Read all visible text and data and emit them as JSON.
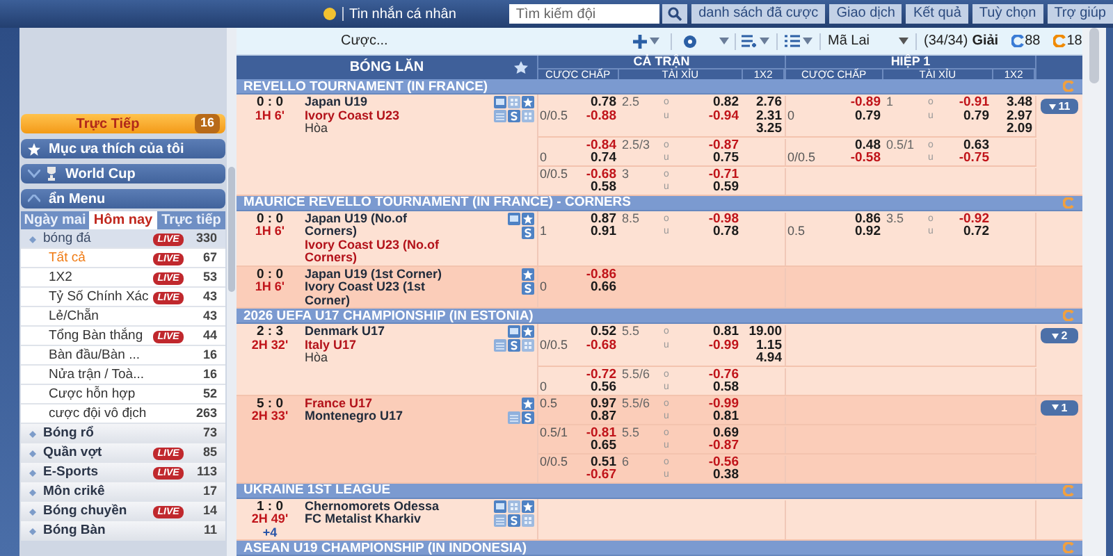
{
  "top_bar": {
    "messages": "Tin nhắn cá nhân",
    "search": {
      "placeholder": "Tìm kiếm đội"
    },
    "buttons": [
      "danh sách đã cược",
      "Giao dịch",
      "Kết quả",
      "Tuỳ chọn",
      "Trợ giúp"
    ]
  },
  "toolbar": {
    "bet_label": "Cược...",
    "region": "Mã Lai",
    "leagues_count": "(34/34)",
    "leagues_label": "Giải",
    "counters": [
      {
        "value": "88",
        "color": "#3a7bd5"
      },
      {
        "value": "18",
        "color": "#f08a00"
      }
    ]
  },
  "sidebar": {
    "live": {
      "label": "Trực Tiếp",
      "count": "16"
    },
    "sections": [
      {
        "label": "Mục ưa thích của tôi",
        "kind": "favorites"
      },
      {
        "label": "World Cup",
        "kind": "trophy"
      },
      {
        "label": "ẩn Menu",
        "kind": "collapse"
      }
    ],
    "tabs": [
      {
        "label": "Ngày mai",
        "selected": false
      },
      {
        "label": "Hôm nay",
        "selected": true
      },
      {
        "label": "Trực tiếp",
        "selected": false
      }
    ],
    "sports": [
      {
        "name": "bóng đá",
        "badge": "LIVE",
        "count": "330",
        "expanded": true,
        "children": [
          {
            "name": "Tất cả",
            "badge": "LIVE",
            "count": "67",
            "selected": true
          },
          {
            "name": "1X2",
            "badge": "LIVE",
            "count": "53",
            "selected": false
          },
          {
            "name": "Tỷ Số Chính Xác",
            "badge": "LIVE",
            "count": "43",
            "selected": false
          },
          {
            "name": "Lẻ/Chẵn",
            "count": "43",
            "selected": false
          },
          {
            "name": "Tổng Bàn thắng",
            "badge": "LIVE",
            "count": "44",
            "selected": false
          },
          {
            "name": "Bàn đầu/Bàn ...",
            "count": "16",
            "selected": false
          },
          {
            "name": "Nửa trận / Toà...",
            "count": "16",
            "selected": false
          },
          {
            "name": "Cược hỗn hợp",
            "count": "52",
            "selected": false
          },
          {
            "name": "cược đội vô địch",
            "count": "263",
            "selected": false
          }
        ]
      },
      {
        "name": "Bóng rổ",
        "count": "73",
        "expanded": false
      },
      {
        "name": "Quần vợt",
        "badge": "LIVE",
        "count": "85",
        "expanded": false
      },
      {
        "name": "E-Sports",
        "badge": "LIVE",
        "count": "113",
        "expanded": false
      },
      {
        "name": "Môn crikê",
        "count": "17",
        "expanded": false
      },
      {
        "name": "Bóng chuyền",
        "badge": "LIVE",
        "count": "14",
        "expanded": false
      },
      {
        "name": "Bóng Bàn",
        "count": "11",
        "expanded": false
      }
    ]
  },
  "table": {
    "title": "BÓNG LĂN",
    "groups": [
      {
        "label": "CẢ TRẬN",
        "columns": [
          "CƯỢC CHẤP",
          "TÀI XỈU",
          "1X2"
        ]
      },
      {
        "label": "HIỆP 1",
        "columns": [
          "CƯỢC CHẤP",
          "TÀI XỈU",
          "1X2"
        ]
      }
    ],
    "leagues": [
      {
        "name": "REVELLO TOURNAMENT (IN FRANCE)",
        "matches": [
          {
            "score": "0 : 0",
            "time": "1H 6'",
            "teams": [
              {
                "name": "Japan U19",
                "favorite": false
              },
              {
                "name": "Ivory Coast U23",
                "favorite": true
              }
            ],
            "draw": "Hòa",
            "tools": {
              "tv": true,
              "stats_top": true,
              "favorite": true,
              "calendar": true,
              "stream": true,
              "stats_bottom": true
            },
            "more": "11",
            "lines": [
              {
                "ft_hdp": {
                  "line": "0/0.5",
                  "home_gives": false,
                  "odds": [
                    "0.78",
                    "-0.88"
                  ]
                },
                "ft_ou": {
                  "line": "2.5",
                  "odds": [
                    [
                      "o",
                      "0.82"
                    ],
                    [
                      "u",
                      "-0.94"
                    ]
                  ]
                },
                "ft_1x2": [
                  "2.76",
                  "2.31",
                  "3.25"
                ],
                "ht_hdp": {
                  "line": "0",
                  "home_gives": false,
                  "odds": [
                    "-0.89",
                    "0.79"
                  ]
                },
                "ht_ou": {
                  "line": "1",
                  "odds": [
                    [
                      "o",
                      "-0.91"
                    ],
                    [
                      "u",
                      "0.79"
                    ]
                  ]
                },
                "ht_1x2": [
                  "3.48",
                  "2.97",
                  "2.09"
                ]
              },
              {
                "ft_hdp": {
                  "line": "0",
                  "home_gives": false,
                  "odds": [
                    "-0.84",
                    "0.74"
                  ]
                },
                "ft_ou": {
                  "line": "2.5/3",
                  "odds": [
                    [
                      "o",
                      "-0.87"
                    ],
                    [
                      "u",
                      "0.75"
                    ]
                  ]
                },
                "ht_hdp": {
                  "line": "0/0.5",
                  "home_gives": false,
                  "odds": [
                    "0.48",
                    "-0.58"
                  ]
                },
                "ht_ou": {
                  "line": "0.5/1",
                  "odds": [
                    [
                      "o",
                      "0.63"
                    ],
                    [
                      "u",
                      "-0.75"
                    ]
                  ]
                }
              },
              {
                "ft_hdp": {
                  "line": "0/0.5",
                  "home_gives": true,
                  "odds": [
                    "-0.68",
                    "0.58"
                  ]
                },
                "ft_ou": {
                  "line": "3",
                  "odds": [
                    [
                      "o",
                      "-0.71"
                    ],
                    [
                      "u",
                      "0.59"
                    ]
                  ]
                }
              }
            ]
          }
        ]
      },
      {
        "name": "MAURICE REVELLO TOURNAMENT (IN FRANCE) - CORNERS",
        "matches": [
          {
            "score": "0 : 0",
            "time": "1H 6'",
            "teams": [
              {
                "name": "Japan U19 (No.of Corners)",
                "favorite": false
              },
              {
                "name": "Ivory Coast U23 (No.of Corners)",
                "favorite": true
              }
            ],
            "tools": {
              "tv": true,
              "stats_top": false,
              "favorite": true,
              "calendar": false,
              "stream": true,
              "stats_bottom": false
            },
            "lines": [
              {
                "ft_hdp": {
                  "line": "1",
                  "home_gives": false,
                  "odds": [
                    "0.87",
                    "0.91"
                  ]
                },
                "ft_ou": {
                  "line": "8.5",
                  "odds": [
                    [
                      "o",
                      "-0.98"
                    ],
                    [
                      "u",
                      "0.78"
                    ]
                  ]
                },
                "ht_hdp": {
                  "line": "0.5",
                  "home_gives": false,
                  "odds": [
                    "0.86",
                    "0.92"
                  ]
                },
                "ht_ou": {
                  "line": "3.5",
                  "odds": [
                    [
                      "o",
                      "-0.92"
                    ],
                    [
                      "u",
                      "0.72"
                    ]
                  ]
                }
              }
            ]
          },
          {
            "score": "0 : 0",
            "time": "1H 6'",
            "teams": [
              {
                "name": "Japan U19 (1st Corner)",
                "favorite": false
              },
              {
                "name": "Ivory Coast U23 (1st Corner)",
                "favorite": false
              }
            ],
            "tools": {
              "tv": false,
              "stats_top": false,
              "favorite": true,
              "calendar": false,
              "stream": true,
              "stats_bottom": false
            },
            "lines": [
              {
                "ft_hdp": {
                  "line": "0",
                  "home_gives": false,
                  "odds": [
                    "-0.86",
                    "0.66"
                  ]
                }
              }
            ]
          }
        ]
      },
      {
        "name": "2026 UEFA U17 CHAMPIONSHIP (IN ESTONIA)",
        "matches": [
          {
            "score": "2 : 3",
            "time": "2H 32'",
            "teams": [
              {
                "name": "Denmark U17",
                "favorite": false
              },
              {
                "name": "Italy U17",
                "favorite": true
              }
            ],
            "draw": "Hòa",
            "tools": {
              "tv": true,
              "stats_top": false,
              "favorite": true,
              "calendar": true,
              "stream": true,
              "stats_bottom": true
            },
            "more": "2",
            "lines": [
              {
                "ft_hdp": {
                  "line": "0/0.5",
                  "home_gives": false,
                  "odds": [
                    "0.52",
                    "-0.68"
                  ]
                },
                "ft_ou": {
                  "line": "5.5",
                  "odds": [
                    [
                      "o",
                      "0.81"
                    ],
                    [
                      "u",
                      "-0.99"
                    ]
                  ]
                },
                "ft_1x2": [
                  "19.00",
                  "1.15",
                  "4.94"
                ]
              },
              {
                "ft_hdp": {
                  "line": "0",
                  "home_gives": false,
                  "odds": [
                    "-0.72",
                    "0.56"
                  ]
                },
                "ft_ou": {
                  "line": "5.5/6",
                  "odds": [
                    [
                      "o",
                      "-0.76"
                    ],
                    [
                      "u",
                      "0.58"
                    ]
                  ]
                }
              }
            ]
          },
          {
            "score": "5 : 0",
            "time": "2H 33'",
            "teams": [
              {
                "name": "France U17",
                "favorite": true
              },
              {
                "name": "Montenegro U17",
                "favorite": false
              }
            ],
            "tools": {
              "tv": false,
              "stats_top": false,
              "favorite": true,
              "calendar": true,
              "stream": true,
              "stats_bottom": false
            },
            "more": "1",
            "lines": [
              {
                "ft_hdp": {
                  "line": "0.5",
                  "home_gives": true,
                  "odds": [
                    "0.97",
                    "0.87"
                  ]
                },
                "ft_ou": {
                  "line": "5.5/6",
                  "odds": [
                    [
                      "o",
                      "-0.99"
                    ],
                    [
                      "u",
                      "0.81"
                    ]
                  ]
                }
              },
              {
                "ft_hdp": {
                  "line": "0.5/1",
                  "home_gives": true,
                  "odds": [
                    "-0.81",
                    "0.65"
                  ]
                },
                "ft_ou": {
                  "line": "5.5",
                  "odds": [
                    [
                      "o",
                      "0.69"
                    ],
                    [
                      "u",
                      "-0.87"
                    ]
                  ]
                }
              },
              {
                "ft_hdp": {
                  "line": "0/0.5",
                  "home_gives": true,
                  "odds": [
                    "0.51",
                    "-0.67"
                  ]
                },
                "ft_ou": {
                  "line": "6",
                  "odds": [
                    [
                      "o",
                      "-0.56"
                    ],
                    [
                      "u",
                      "0.38"
                    ]
                  ]
                }
              }
            ]
          }
        ]
      },
      {
        "name": "UKRAINE 1ST LEAGUE",
        "matches": [
          {
            "score": "1 : 0",
            "time": "2H 49'",
            "extra": "+4",
            "teams": [
              {
                "name": "Chernomorets Odessa",
                "favorite": false
              },
              {
                "name": "FC Metalist Kharkiv",
                "favorite": false
              }
            ],
            "tools": {
              "tv": true,
              "stats_top": true,
              "favorite": true,
              "calendar": true,
              "stream": true,
              "stats_bottom": true
            }
          }
        ]
      },
      {
        "name": "ASEAN U19 CHAMPIONSHIP (IN INDONESIA)"
      }
    ]
  }
}
